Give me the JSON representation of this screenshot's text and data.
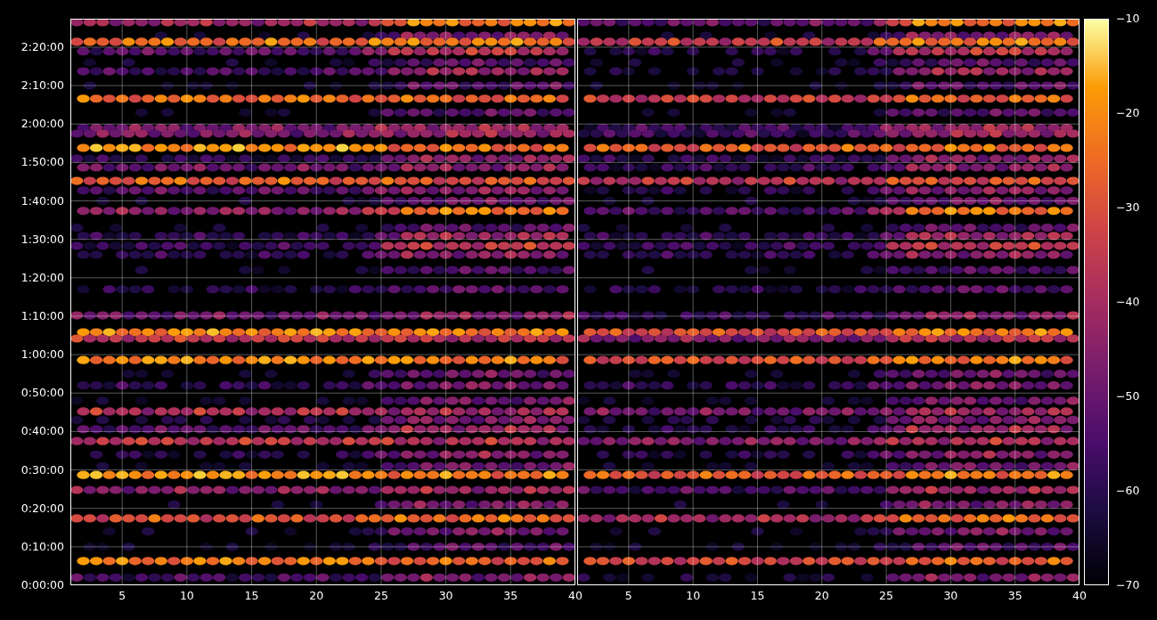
{
  "panels": [
    {
      "y_ticks": [
        "2:20:00",
        "2:10:00",
        "2:00:00",
        "1:50:00",
        "1:40:00",
        "1:30:00",
        "1:20:00",
        "1:10:00",
        "1:00:00",
        "0:50:00",
        "0:40:00",
        "0:30:00",
        "0:20:00",
        "0:10:00",
        "0:00:00"
      ],
      "x_ticks": [
        "5",
        "10",
        "15",
        "20",
        "25",
        "30",
        "35",
        "40"
      ]
    },
    {
      "x_ticks": [
        "5",
        "10",
        "15",
        "20",
        "25",
        "30",
        "35",
        "40"
      ]
    }
  ],
  "colorbar": {
    "ticks": [
      "−10",
      "−20",
      "−30",
      "−40",
      "−50",
      "−60",
      "−70"
    ]
  }
}
